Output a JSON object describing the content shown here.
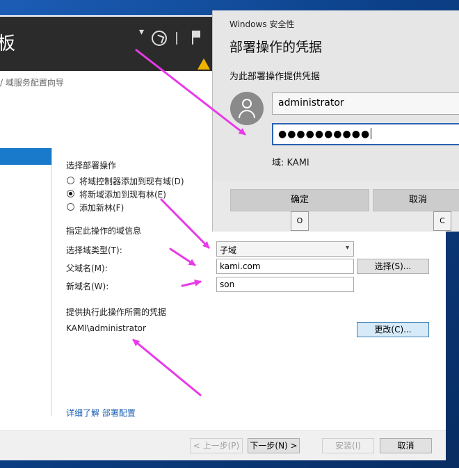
{
  "window": {
    "title_fragment": "板",
    "breadcrumb": "/ 域服务配置向导"
  },
  "form": {
    "section_deploy": "选择部署操作",
    "options": [
      {
        "label": "将域控制器添加到现有域(D)",
        "selected": false
      },
      {
        "label": "将新域添加到现有林(E)",
        "selected": true
      },
      {
        "label": "添加新林(F)",
        "selected": false
      }
    ],
    "section_domain_info": "指定此操作的域信息",
    "domain_type_label": "选择域类型(T):",
    "domain_type_value": "子域",
    "parent_label": "父域名(M):",
    "parent_value": "kami.com",
    "select_button": "选择(S)...",
    "new_domain_label": "新域名(W):",
    "new_domain_value": "son",
    "section_creds": "提供执行此操作所需的凭据",
    "creds_value": "KAMI\\administrator",
    "change_button": "更改(C)...",
    "more_link": "详细了解 部署配置"
  },
  "footer": {
    "prev": "< 上一步(P)",
    "next": "下一步(N) >",
    "install": "安装(I)",
    "cancel": "取消"
  },
  "dialog": {
    "small_title": "Windows 安全性",
    "title": "部署操作的凭据",
    "subtitle": "为此部署操作提供凭据",
    "username": "administrator",
    "password_mask": "●●●●●●●●●●",
    "domain": "域: KAMI",
    "ok": "确定",
    "cancel": "取消",
    "key_ok": "O",
    "key_cancel": "C"
  },
  "colors": {
    "accent": "#1979ca",
    "arrow": "#e83ae6",
    "header_dark": "#2b2b2b",
    "dialog_bg": "#e6e6e6"
  }
}
